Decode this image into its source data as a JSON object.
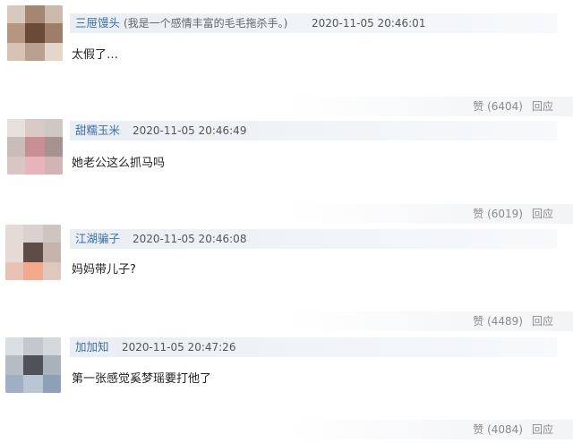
{
  "comments": [
    {
      "username": "三屉馒头",
      "bio": "(我是一个感情丰富的毛毛拖杀手。)",
      "timestamp": "2020-11-05 20:46:01",
      "text": "太假了…",
      "like_label": "赞",
      "like_count": "(6404)",
      "reply_label": "回应"
    },
    {
      "username": "甜糯玉米",
      "bio": "",
      "timestamp": "2020-11-05 20:46:49",
      "text": "她老公这么抓马吗",
      "like_label": "赞",
      "like_count": "(6019)",
      "reply_label": "回应"
    },
    {
      "username": "江湖骗子",
      "bio": "",
      "timestamp": "2020-11-05 20:46:08",
      "text": "妈妈带儿子?",
      "like_label": "赞",
      "like_count": "(4489)",
      "reply_label": "回应"
    },
    {
      "username": "加加知",
      "bio": "",
      "timestamp": "2020-11-05 20:47:26",
      "text": "第一张感觉奚梦瑶要打他了",
      "like_label": "赞",
      "like_count": "(4084)",
      "reply_label": "回应"
    }
  ],
  "colors": {
    "username": "#3e6e9e",
    "header_bar": "#eef2f6",
    "text": "#222222",
    "muted": "#8a8a8a"
  }
}
